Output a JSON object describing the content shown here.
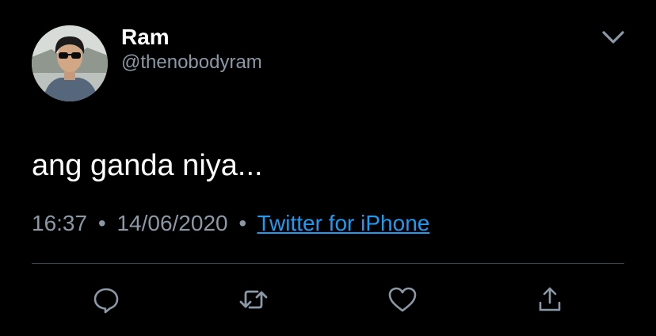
{
  "user": {
    "display_name": "Ram",
    "handle": "@thenobodyram"
  },
  "tweet": {
    "text": "ang ganda niya...",
    "time": "16:37",
    "separator": "•",
    "date": "14/06/2020",
    "source": "Twitter for iPhone"
  },
  "icons": {
    "menu": "chevron-down-icon",
    "reply": "reply-icon",
    "retweet": "retweet-icon",
    "like": "heart-icon",
    "share": "share-icon"
  },
  "colors": {
    "background": "#000000",
    "primary_text": "#ffffff",
    "secondary_text": "#8b98a5",
    "link": "#1d9bf0",
    "divider": "#38444d"
  }
}
